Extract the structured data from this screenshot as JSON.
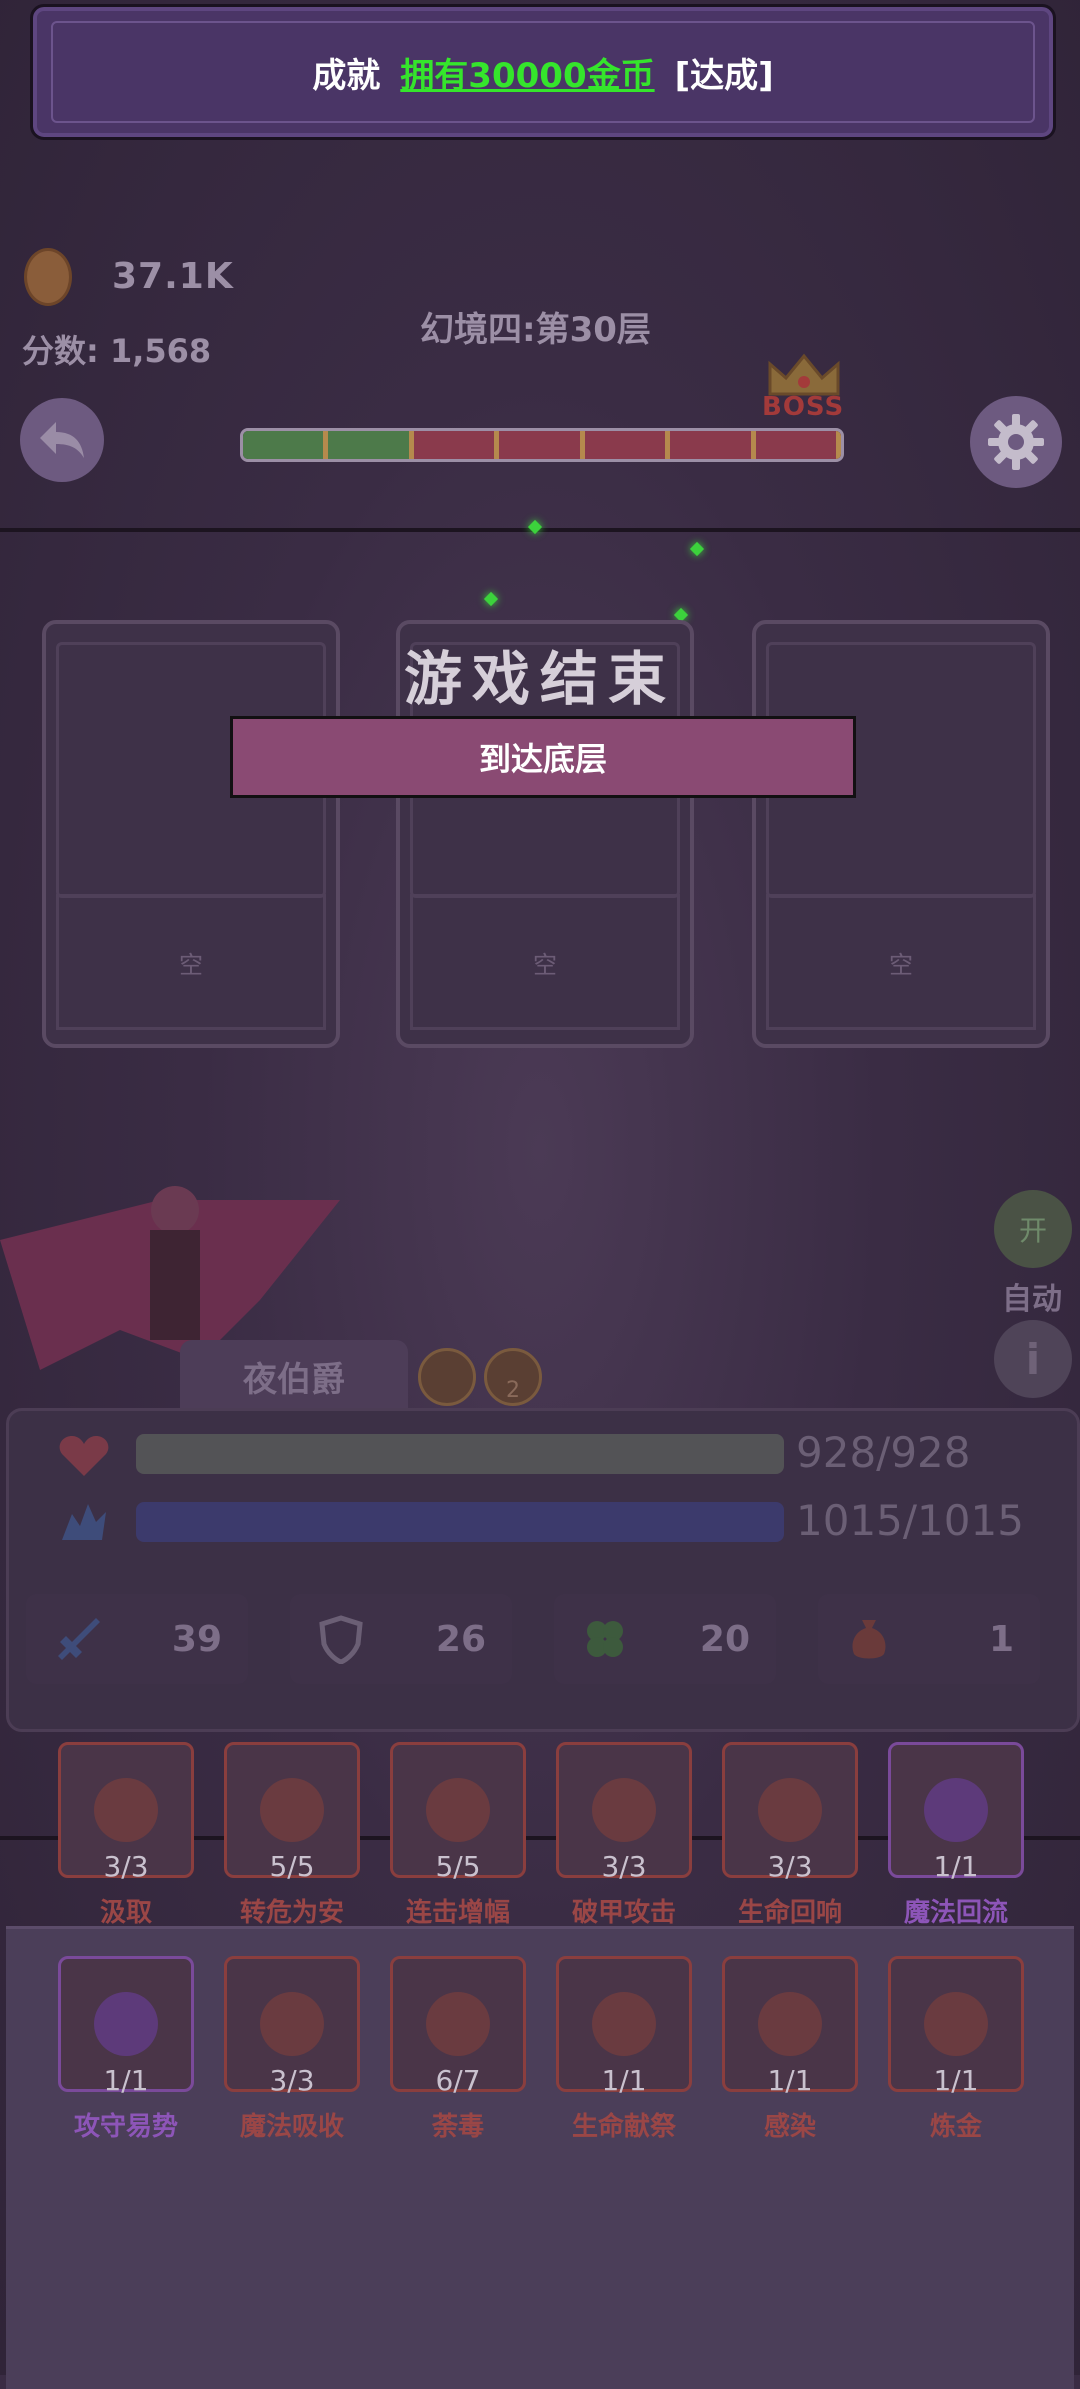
{
  "achievement": {
    "prefix": "成就",
    "name": "拥有30000金币",
    "status": "[达成]"
  },
  "hud": {
    "coins": "37.1K",
    "score": "分数: 1,568",
    "level": "幻境四:第30层",
    "boss_label": "BOSS",
    "progress_segments": [
      "cleared",
      "cleared",
      "pending",
      "pending",
      "pending",
      "pending",
      "pending"
    ]
  },
  "game_over": {
    "title": "游戏结束",
    "reason": "到达底层"
  },
  "cards": [
    {
      "label": "空"
    },
    {
      "label": "空"
    },
    {
      "label": "空"
    }
  ],
  "character": {
    "name": "夜伯爵",
    "buff_count": "2"
  },
  "controls": {
    "auto_toggle": "开",
    "auto_label": "自动",
    "info": "i"
  },
  "stats": {
    "hp": "928/928",
    "mp": "1015/1015",
    "attack": "39",
    "defense": "26",
    "luck": "20",
    "potion": "1"
  },
  "skills_row1": [
    {
      "count": "3/3",
      "name": "汲取",
      "tier": "red"
    },
    {
      "count": "5/5",
      "name": "转危为安",
      "tier": "red"
    },
    {
      "count": "5/5",
      "name": "连击增幅",
      "tier": "red"
    },
    {
      "count": "3/3",
      "name": "破甲攻击",
      "tier": "red"
    },
    {
      "count": "3/3",
      "name": "生命回响",
      "tier": "red"
    },
    {
      "count": "1/1",
      "name": "魔法回流",
      "tier": "purple"
    }
  ],
  "skills_row2": [
    {
      "count": "1/1",
      "name": "攻守易势",
      "tier": "purple"
    },
    {
      "count": "3/3",
      "name": "魔法吸收",
      "tier": "red"
    },
    {
      "count": "6/7",
      "name": "荼毒",
      "tier": "red"
    },
    {
      "count": "1/1",
      "name": "生命献祭",
      "tier": "red"
    },
    {
      "count": "1/1",
      "name": "感染",
      "tier": "red"
    },
    {
      "count": "1/1",
      "name": "炼金",
      "tier": "red"
    }
  ],
  "colors": {
    "accent_green": "#35e52c",
    "banner": "#4a3566",
    "reason_box": "#8a4a73"
  }
}
